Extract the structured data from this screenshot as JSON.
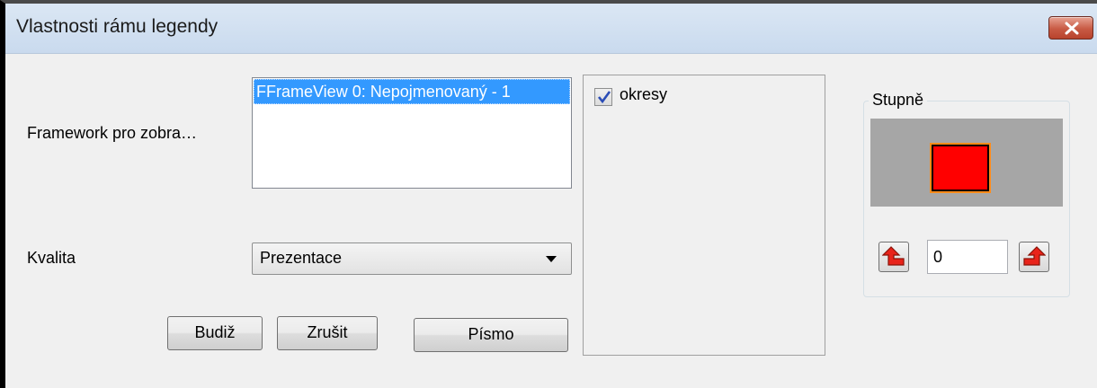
{
  "window": {
    "title": "Vlastnosti rámu legendy",
    "close_icon": "close-icon"
  },
  "form": {
    "framework_label": "Framework pro zobra…",
    "framework_items": [
      "FFrameView 0: Nepojmenovaný - 1"
    ],
    "framework_selected": "FFrameView 0: Nepojmenovaný - 1",
    "quality_label": "Kvalita",
    "quality_value": "Prezentace"
  },
  "layers": {
    "items": [
      {
        "label": "okresy",
        "checked": true
      }
    ]
  },
  "degrees": {
    "title": "Stupně",
    "preview_fill": "#ff0000",
    "preview_outline": "#ff8c1a",
    "preview_background": "#a6a6a6",
    "value": "0",
    "left_icon": "rotate-left-arrow-icon",
    "right_icon": "rotate-right-arrow-icon"
  },
  "buttons": {
    "ok": "Budiž",
    "cancel": "Zrušit",
    "font": "Písmo"
  },
  "colors": {
    "selection": "#3399ff",
    "close_button": "#c85a44",
    "arrow_red": "#e8231a"
  }
}
